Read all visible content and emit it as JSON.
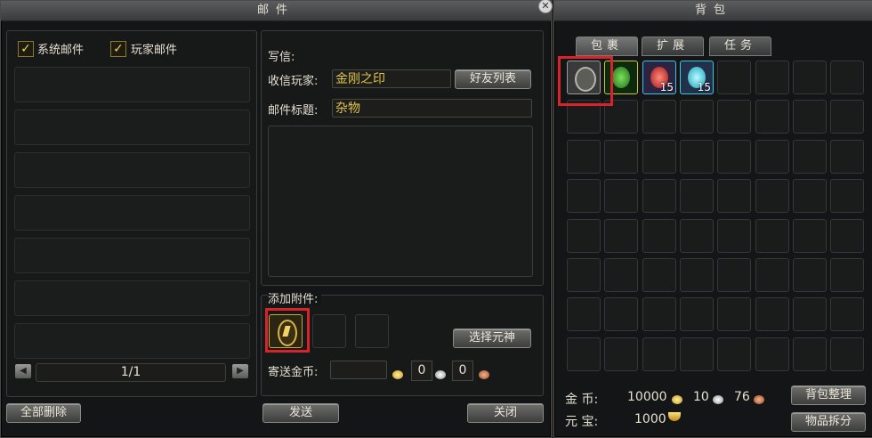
{
  "mail": {
    "title": "邮件",
    "filters": [
      {
        "label": "系统邮件",
        "checked": true
      },
      {
        "label": "玩家邮件",
        "checked": true
      }
    ],
    "page_indicator": "1/1",
    "delete_all_label": "全部删除",
    "compose": {
      "section_label": "写信:",
      "recipient_label": "收信玩家:",
      "recipient_value": "金刚之印",
      "friend_list_label": "好友列表",
      "subject_label": "邮件标题:",
      "subject_value": "杂物",
      "body_value": ""
    },
    "attachments": {
      "section_label": "添加附件:",
      "select_soul_label": "选择元神",
      "send_gold_label": "寄送金币:",
      "send_gold_value": "",
      "silver_value": "0",
      "copper_value": "0"
    },
    "send_label": "发送",
    "close_label": "关闭"
  },
  "bag": {
    "title": "背包",
    "tabs": [
      {
        "label": "包裹",
        "active": true
      },
      {
        "label": "扩展",
        "active": false
      },
      {
        "label": "任务",
        "active": false
      }
    ],
    "items": [
      {
        "name": "rune-token",
        "count": ""
      },
      {
        "name": "green-mask",
        "count": ""
      },
      {
        "name": "red-gems",
        "count": "15"
      },
      {
        "name": "cyan-gems",
        "count": "15"
      }
    ],
    "gold_label": "金 币:",
    "gold_value": "10000",
    "silver_value": "10",
    "copper_value": "76",
    "yuanbao_label": "元 宝:",
    "yuanbao_value": "1000",
    "sort_label": "背包整理",
    "split_label": "物品拆分"
  },
  "colors": {
    "highlight": "#d9232a",
    "accent_gold": "#e0c34a"
  }
}
